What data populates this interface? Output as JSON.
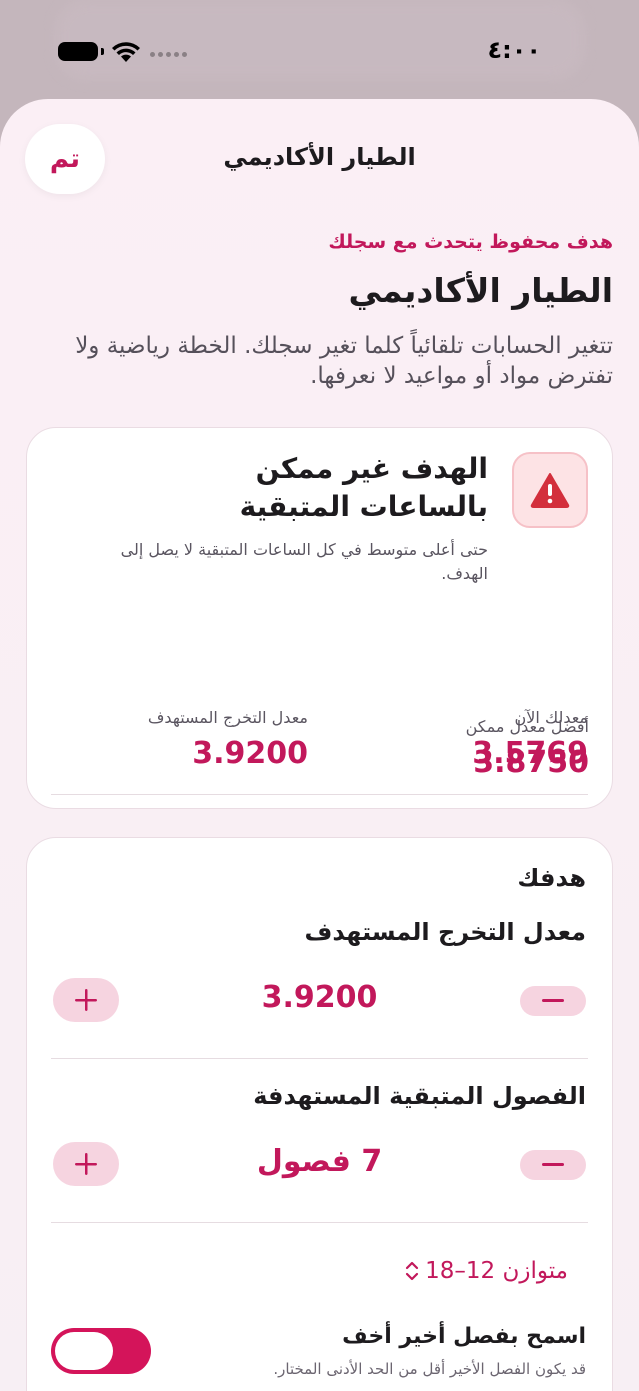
{
  "status_bar": {
    "time": "٤:٠٠"
  },
  "sheet": {
    "done_label": "تم",
    "title": "الطيار الأكاديمي"
  },
  "intro": {
    "eyebrow": "هدف محفوظ يتحدث مع سجلك",
    "heading": "الطيار الأكاديمي",
    "description": "تتغير الحسابات تلقائياً كلما تغير سجلك. الخطة رياضية ولا تفترض مواد أو مواعيد لا نعرفها."
  },
  "warning_card": {
    "icon": "warning-triangle-icon",
    "title": "الهدف غير ممكن بالساعات المتبقية",
    "body": "حتى أعلى متوسط في كل الساعات المتبقية لا يصل إلى الهدف.",
    "current_gpa_label": "معدلك الآن",
    "current_gpa_value": "3.5769",
    "target_gpa_label": "معدل التخرج المستهدف",
    "target_gpa_value": "3.9200",
    "best_gpa_label": "أفضل معدل ممكن",
    "best_gpa_value": "3.8750"
  },
  "goal_card": {
    "section_title": "هدفك",
    "target_gpa_title": "معدل التخرج المستهدف",
    "target_gpa_value": "3.9200",
    "remaining_terms_title": "الفصول المتبقية المستهدفة",
    "remaining_terms_value": "7 فصول",
    "load_mode": "متوازن 12–18",
    "lighter_term_label": "اسمح بفصل أخير أخف",
    "lighter_term_sub": "قد يكون الفصل الأخير أقل من الحد الأدنى المختار.",
    "lighter_term_enabled": true
  },
  "colors": {
    "accent": "#c2185b",
    "toggle_on": "#d4145a",
    "warning_icon": "#d32f3c"
  }
}
